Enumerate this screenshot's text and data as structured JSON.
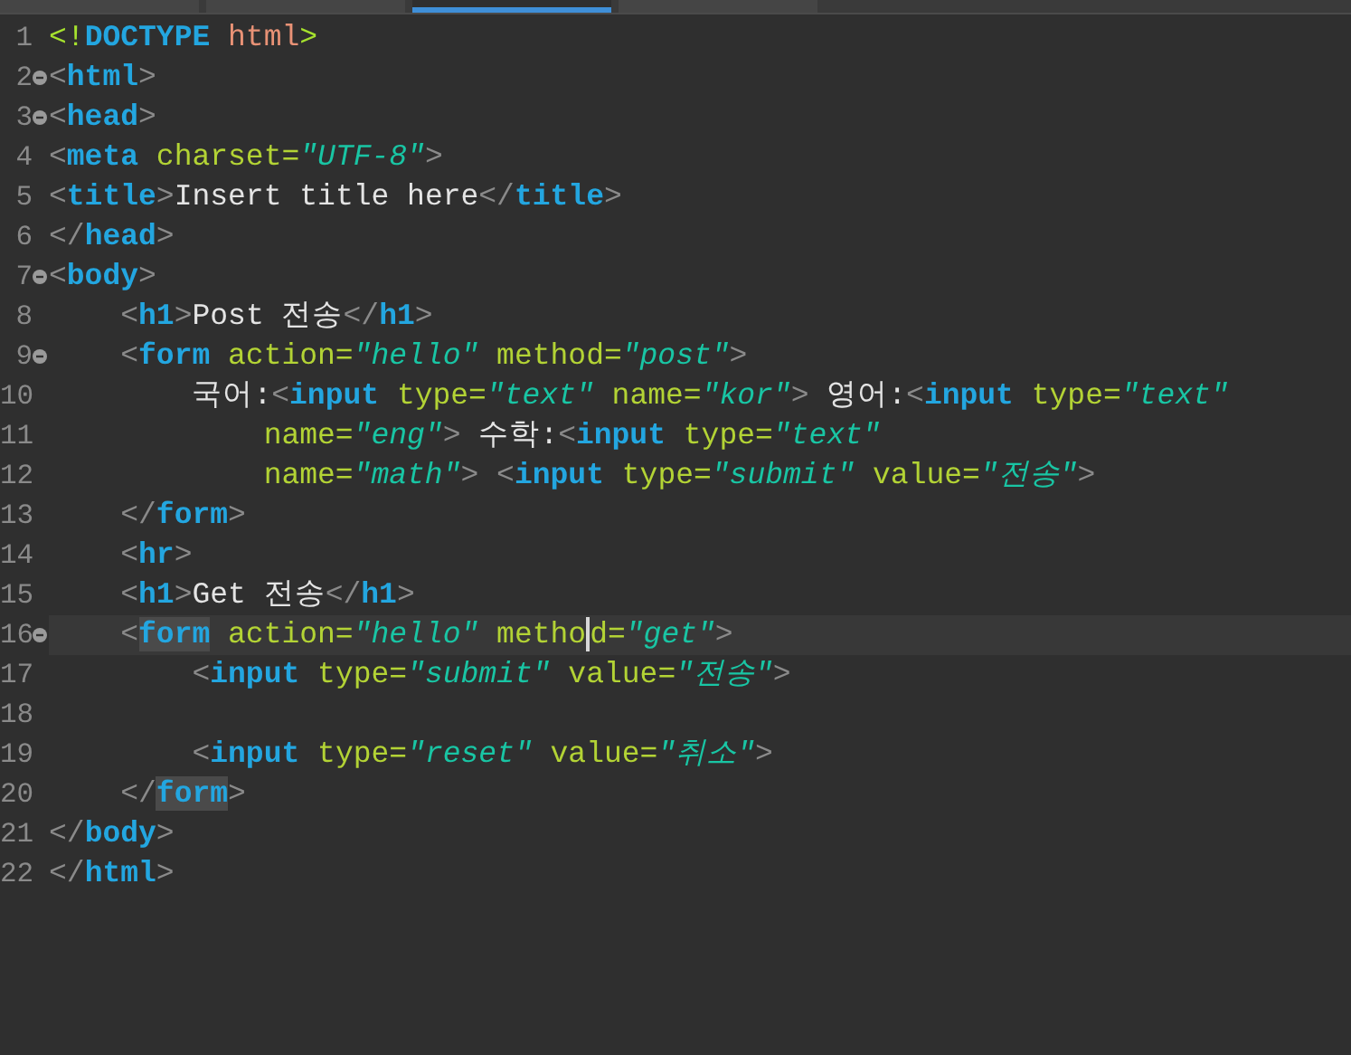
{
  "tabs": [
    {
      "selected": false
    },
    {
      "selected": false
    },
    {
      "selected": true
    },
    {
      "selected": false
    }
  ],
  "lines": [
    {
      "n": "1",
      "tokens": [
        {
          "kind": "dd",
          "t": "<!"
        },
        {
          "kind": "doctype",
          "t": "DOCTYPE"
        },
        {
          "kind": "dv",
          "t": " html"
        },
        {
          "kind": "dd",
          "t": ">"
        }
      ]
    },
    {
      "n": "2",
      "fold": true,
      "tokens": [
        {
          "kind": "punct",
          "t": "<"
        },
        {
          "kind": "tag",
          "t": "html"
        },
        {
          "kind": "punct",
          "t": ">"
        }
      ]
    },
    {
      "n": "3",
      "fold": true,
      "tokens": [
        {
          "kind": "punct",
          "t": "<"
        },
        {
          "kind": "tag",
          "t": "head"
        },
        {
          "kind": "punct",
          "t": ">"
        }
      ]
    },
    {
      "n": "4",
      "tokens": [
        {
          "kind": "punct",
          "t": "<"
        },
        {
          "kind": "tag",
          "t": "meta"
        },
        {
          "kind": "attr",
          "t": " charset="
        },
        {
          "kind": "str",
          "t": "\"UTF-8\""
        },
        {
          "kind": "punct",
          "t": ">"
        }
      ]
    },
    {
      "n": "5",
      "tokens": [
        {
          "kind": "punct",
          "t": "<"
        },
        {
          "kind": "tag",
          "t": "title"
        },
        {
          "kind": "punct",
          "t": ">"
        },
        {
          "kind": "text",
          "t": "Insert title here"
        },
        {
          "kind": "punct",
          "t": "</"
        },
        {
          "kind": "tag",
          "t": "title"
        },
        {
          "kind": "punct",
          "t": ">"
        }
      ]
    },
    {
      "n": "6",
      "tokens": [
        {
          "kind": "punct",
          "t": "</"
        },
        {
          "kind": "tag",
          "t": "head"
        },
        {
          "kind": "punct",
          "t": ">"
        }
      ]
    },
    {
      "n": "7",
      "fold": true,
      "tokens": [
        {
          "kind": "punct",
          "t": "<"
        },
        {
          "kind": "tag",
          "t": "body"
        },
        {
          "kind": "punct",
          "t": ">"
        }
      ]
    },
    {
      "n": "8",
      "tokens": [
        {
          "kind": "punct",
          "t": "    <"
        },
        {
          "kind": "tag",
          "t": "h1"
        },
        {
          "kind": "punct",
          "t": ">"
        },
        {
          "kind": "text",
          "t": "Post 전송"
        },
        {
          "kind": "punct",
          "t": "</"
        },
        {
          "kind": "tag",
          "t": "h1"
        },
        {
          "kind": "punct",
          "t": ">"
        }
      ]
    },
    {
      "n": "9",
      "fold": true,
      "tokens": [
        {
          "kind": "punct",
          "t": "    <"
        },
        {
          "kind": "tag",
          "t": "form"
        },
        {
          "kind": "attr",
          "t": " action="
        },
        {
          "kind": "str",
          "t": "\"hello\""
        },
        {
          "kind": "attr",
          "t": " method="
        },
        {
          "kind": "str",
          "t": "\"post\""
        },
        {
          "kind": "punct",
          "t": ">"
        }
      ]
    },
    {
      "n": "10",
      "tokens": [
        {
          "kind": "text",
          "t": "        국어:"
        },
        {
          "kind": "punct",
          "t": "<"
        },
        {
          "kind": "tag",
          "t": "input"
        },
        {
          "kind": "attr",
          "t": " type="
        },
        {
          "kind": "str",
          "t": "\"text\""
        },
        {
          "kind": "attr",
          "t": " name="
        },
        {
          "kind": "str",
          "t": "\"kor\""
        },
        {
          "kind": "punct",
          "t": ">"
        },
        {
          "kind": "text",
          "t": " 영어:"
        },
        {
          "kind": "punct",
          "t": "<"
        },
        {
          "kind": "tag",
          "t": "input"
        },
        {
          "kind": "attr",
          "t": " type="
        },
        {
          "kind": "str",
          "t": "\"text\""
        }
      ]
    },
    {
      "n": "11",
      "tokens": [
        {
          "kind": "attr",
          "t": "            name="
        },
        {
          "kind": "str",
          "t": "\"eng\""
        },
        {
          "kind": "punct",
          "t": ">"
        },
        {
          "kind": "text",
          "t": " 수학:"
        },
        {
          "kind": "punct",
          "t": "<"
        },
        {
          "kind": "tag",
          "t": "input"
        },
        {
          "kind": "attr",
          "t": " type="
        },
        {
          "kind": "str",
          "t": "\"text\""
        }
      ]
    },
    {
      "n": "12",
      "tokens": [
        {
          "kind": "attr",
          "t": "            name="
        },
        {
          "kind": "str",
          "t": "\"math\""
        },
        {
          "kind": "punct",
          "t": "> <"
        },
        {
          "kind": "tag",
          "t": "input"
        },
        {
          "kind": "attr",
          "t": " type="
        },
        {
          "kind": "str",
          "t": "\"submit\""
        },
        {
          "kind": "attr",
          "t": " value="
        },
        {
          "kind": "str",
          "t": "\"전송\""
        },
        {
          "kind": "punct",
          "t": ">"
        }
      ]
    },
    {
      "n": "13",
      "tokens": [
        {
          "kind": "punct",
          "t": "    </"
        },
        {
          "kind": "tag",
          "t": "form"
        },
        {
          "kind": "punct",
          "t": ">"
        }
      ]
    },
    {
      "n": "14",
      "tokens": [
        {
          "kind": "punct",
          "t": "    <"
        },
        {
          "kind": "tag",
          "t": "hr"
        },
        {
          "kind": "punct",
          "t": ">"
        }
      ]
    },
    {
      "n": "15",
      "tokens": [
        {
          "kind": "punct",
          "t": "    <"
        },
        {
          "kind": "tag",
          "t": "h1"
        },
        {
          "kind": "punct",
          "t": ">"
        },
        {
          "kind": "text",
          "t": "Get 전송"
        },
        {
          "kind": "punct",
          "t": "</"
        },
        {
          "kind": "tag",
          "t": "h1"
        },
        {
          "kind": "punct",
          "t": ">"
        }
      ]
    },
    {
      "n": "16",
      "fold": true,
      "current": true,
      "tokens": [
        {
          "kind": "punct",
          "t": "    <"
        },
        {
          "kind": "tag",
          "t": "form",
          "matched": true
        },
        {
          "kind": "attr",
          "t": " action="
        },
        {
          "kind": "str",
          "t": "\"hello\""
        },
        {
          "kind": "attr",
          "t": " metho",
          "caret": true
        },
        {
          "kind": "attr",
          "t": "d="
        },
        {
          "kind": "str",
          "t": "\"get\""
        },
        {
          "kind": "punct",
          "t": ">"
        }
      ]
    },
    {
      "n": "17",
      "tokens": [
        {
          "kind": "punct",
          "t": "        <"
        },
        {
          "kind": "tag",
          "t": "input"
        },
        {
          "kind": "attr",
          "t": " type="
        },
        {
          "kind": "str",
          "t": "\"submit\""
        },
        {
          "kind": "attr",
          "t": " value="
        },
        {
          "kind": "str",
          "t": "\"전송\""
        },
        {
          "kind": "punct",
          "t": ">"
        }
      ]
    },
    {
      "n": "18"
    },
    {
      "n": "19",
      "tokens": [
        {
          "kind": "punct",
          "t": "        <"
        },
        {
          "kind": "tag",
          "t": "input"
        },
        {
          "kind": "attr",
          "t": " type="
        },
        {
          "kind": "str",
          "t": "\"reset\""
        },
        {
          "kind": "attr",
          "t": " value="
        },
        {
          "kind": "str",
          "t": "\"취소\""
        },
        {
          "kind": "punct",
          "t": ">"
        }
      ]
    },
    {
      "n": "20",
      "tokens": [
        {
          "kind": "punct",
          "t": "    </"
        },
        {
          "kind": "tag",
          "t": "form",
          "matched": true
        },
        {
          "kind": "punct",
          "t": ">"
        }
      ]
    },
    {
      "n": "21",
      "tokens": [
        {
          "kind": "punct",
          "t": "</"
        },
        {
          "kind": "tag",
          "t": "body"
        },
        {
          "kind": "punct",
          "t": ">"
        }
      ]
    },
    {
      "n": "22",
      "tokens": [
        {
          "kind": "punct",
          "t": "</"
        },
        {
          "kind": "tag",
          "t": "html"
        },
        {
          "kind": "punct",
          "t": ">"
        }
      ]
    }
  ]
}
